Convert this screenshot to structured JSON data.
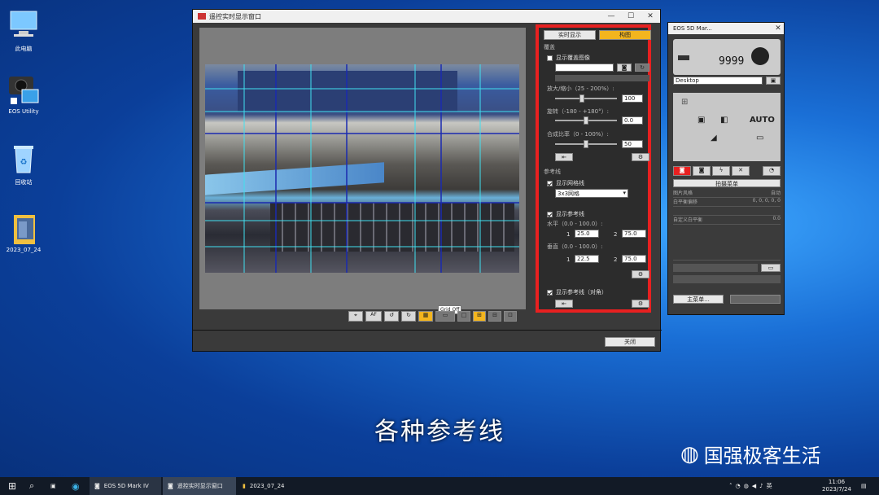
{
  "desktop": {
    "icons": [
      {
        "label": "此电脑"
      },
      {
        "label": "EOS Utility"
      },
      {
        "label": "回收站"
      },
      {
        "label": "2023_07_24"
      }
    ]
  },
  "liveview": {
    "title": "遥控实时显示窗口",
    "tabs": {
      "live": "实时显示",
      "compose": "构图"
    },
    "overlay": {
      "section": "覆盖",
      "show_image": "显示覆盖图像",
      "scale": "放大/缩小（25 - 200%）:",
      "scale_val": "100",
      "rotate": "旋转（-180 - +180°）:",
      "rotate_val": "0.0",
      "opacity": "合成比率（0 - 100%）:",
      "opacity_val": "50"
    },
    "guides": {
      "section": "参考线",
      "grid_check": "显示网格线",
      "grid_select": "3x3网格",
      "ratio_check": "显示参考线",
      "horizontal": "水平（0.0 - 100.0）:",
      "vertical": "垂直（0.0 - 100.0）:",
      "h1": "25.0",
      "h2": "75.0",
      "v1": "22.5",
      "v2": "75.0",
      "idx1": "1",
      "idx2": "2",
      "diag_check": "显示参考线（对角）"
    },
    "close": "关闭",
    "tooltip": "Grid Off"
  },
  "eos": {
    "title": "EOS 5D Mar...",
    "shots": "9999",
    "folder": "Desktop",
    "auto": "AUTO",
    "tabs_title": "拍摄菜单",
    "menu": [
      {
        "name": "图片风格",
        "value": "自动"
      },
      {
        "name": "白平衡偏移",
        "value": "0, 0, 0, 0, 0"
      },
      {
        "name": "",
        "value": ""
      },
      {
        "name": "自定义白平衡",
        "value": "0.0"
      }
    ],
    "bottom": [
      "主菜单...",
      ""
    ]
  },
  "subtitle": "各种参考线",
  "watermark": "国强极客生活",
  "taskbar": {
    "apps": [
      {
        "label": "EOS 5D Mark IV"
      },
      {
        "label": "遥控实时显示窗口"
      },
      {
        "label": "2023_07_24"
      }
    ],
    "ime": "英",
    "time": "11:06",
    "date": "2023/7/24"
  },
  "colors": {
    "highlight": "#e82020",
    "accent": "#f3b51e"
  }
}
